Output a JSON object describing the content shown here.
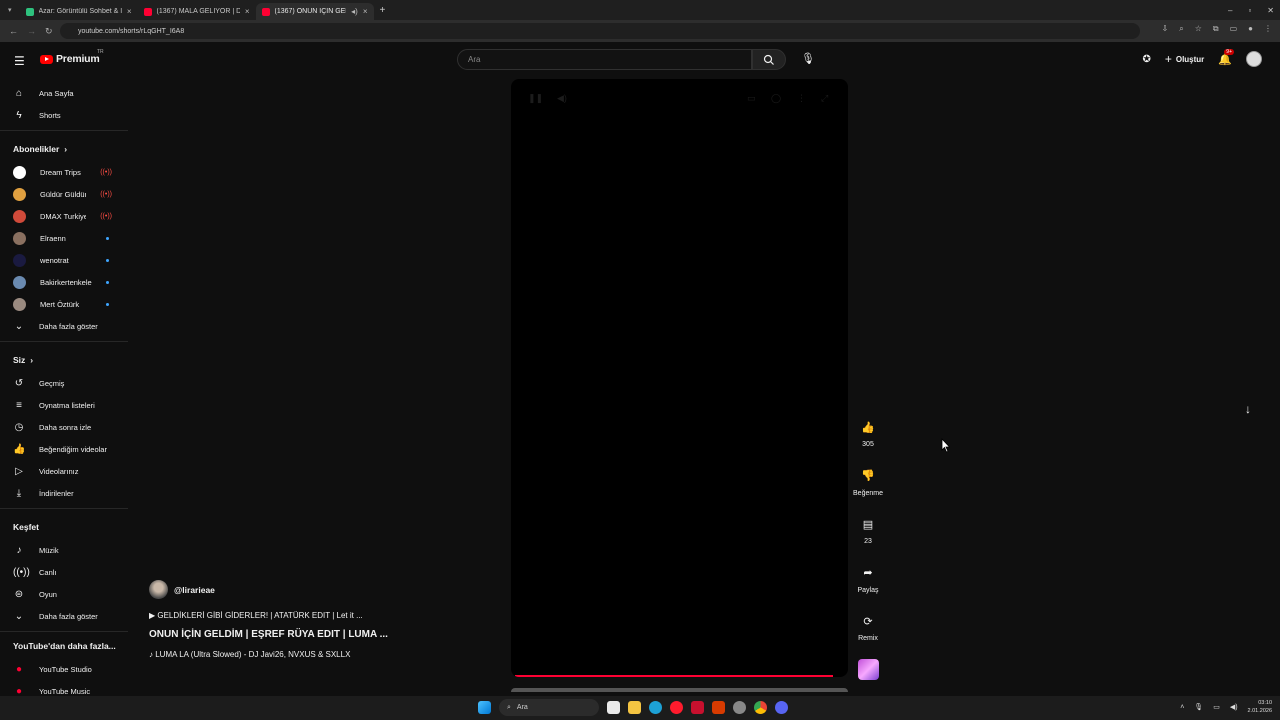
{
  "browser": {
    "tabs": [
      {
        "title": "Azar: Görüntülü Sohbet & I",
        "favicon_color": "#2ec27e",
        "active": false
      },
      {
        "title": "(1367) MALA GELİYOR | DEADF",
        "favicon_color": "#ff0033",
        "active": false
      },
      {
        "title": "(1367) ONUN İÇİN GELDİM",
        "favicon_color": "#ff0033",
        "active": true
      }
    ],
    "new_tab": "+",
    "url": "youtube.com/shorts/rLqGHT_I6A8"
  },
  "header": {
    "logo_text": "Premium",
    "country": "TR",
    "search_placeholder": "Ara",
    "create_label": "Oluştur",
    "notif_badge": "9+"
  },
  "sidebar": {
    "main": [
      {
        "label": "Ana Sayfa",
        "icon": "home-icon"
      },
      {
        "label": "Shorts",
        "icon": "shorts-icon"
      }
    ],
    "subs_heading": "Abonelikler",
    "subs": [
      {
        "label": "Dream Trips",
        "color": "#ffffff",
        "status": "live"
      },
      {
        "label": "Güldür Güldür",
        "color": "#e0a040",
        "status": "live"
      },
      {
        "label": "DMAX Turkiye",
        "color": "#d04a3a",
        "status": "live"
      },
      {
        "label": "Elraenn",
        "color": "#8a7060",
        "status": "new"
      },
      {
        "label": "wenotrat",
        "color": "#1a1a40",
        "status": "new"
      },
      {
        "label": "Bakirkertenkele31",
        "color": "#6a8ab0",
        "status": "new"
      },
      {
        "label": "Mert Öztürk",
        "color": "#9a8a80",
        "status": "new"
      }
    ],
    "show_more": "Daha fazla göster",
    "you_heading": "Siz",
    "you": [
      {
        "label": "Geçmiş",
        "icon": "history-icon"
      },
      {
        "label": "Oynatma listeleri",
        "icon": "playlist-icon"
      },
      {
        "label": "Daha sonra izle",
        "icon": "watch-later-icon"
      },
      {
        "label": "Beğendiğim videolar",
        "icon": "like-icon"
      },
      {
        "label": "Videolarınız",
        "icon": "your-videos-icon"
      },
      {
        "label": "İndirilenler",
        "icon": "download-icon"
      }
    ],
    "explore_heading": "Keşfet",
    "explore": [
      {
        "label": "Müzik",
        "icon": "music-icon"
      },
      {
        "label": "Canlı",
        "icon": "live-icon"
      },
      {
        "label": "Oyun",
        "icon": "gaming-icon"
      }
    ],
    "show_more2": "Daha fazla göster",
    "more_heading": "YouTube'dan daha fazla...",
    "more": [
      {
        "label": "YouTube Studio"
      },
      {
        "label": "YouTube Music"
      }
    ]
  },
  "short": {
    "channel": "@lirarieae",
    "song_line": "▶ GELDİKLERİ GİBİ GİDERLER! | ATATÜRK EDIT | Let it ...",
    "title": "ONUN İÇİN GELDİM | EŞREF RÜYA EDIT | LUMA ...",
    "audio": "♪ LUMA LA (Ultra Slowed) - DJ Javi26, NVXUS & SXLLX"
  },
  "actions": {
    "like_count": "305",
    "dislike_label": "Beğenme",
    "comment_count": "23",
    "share_label": "Paylaş",
    "remix_label": "Remix"
  },
  "taskbar": {
    "search_label": "Ara",
    "time": "03:10",
    "date": "2.01.2026"
  }
}
